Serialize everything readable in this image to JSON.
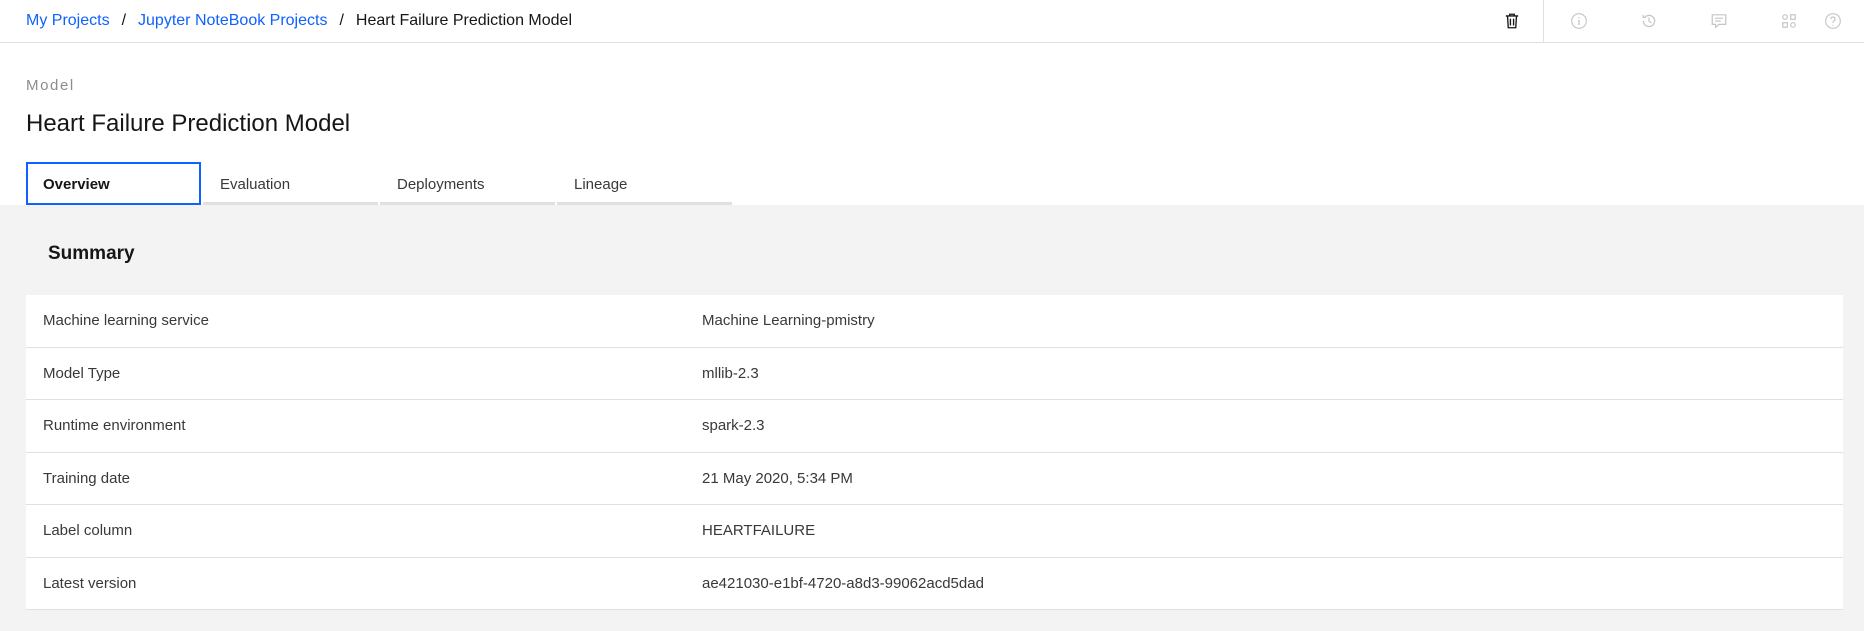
{
  "breadcrumb": {
    "items": [
      "My Projects",
      "Jupyter NoteBook Projects"
    ],
    "separator": "/",
    "current": "Heart Failure Prediction Model"
  },
  "toolbar": {
    "icons": [
      "trash-icon",
      "information-icon",
      "history-icon",
      "comments-icon",
      "data-assets-icon",
      "help-icon"
    ]
  },
  "header": {
    "eyebrow": "Model",
    "title": "Heart Failure Prediction Model"
  },
  "tabs": [
    {
      "label": "Overview",
      "active": true
    },
    {
      "label": "Evaluation",
      "active": false
    },
    {
      "label": "Deployments",
      "active": false
    },
    {
      "label": "Lineage",
      "active": false
    }
  ],
  "summary": {
    "title": "Summary",
    "rows": [
      {
        "label": "Machine learning service",
        "value": "Machine Learning-pmistry"
      },
      {
        "label": "Model Type",
        "value": "mllib-2.3"
      },
      {
        "label": "Runtime environment",
        "value": "spark-2.3"
      },
      {
        "label": "Training date",
        "value": "21 May 2020, 5:34 PM"
      },
      {
        "label": "Label column",
        "value": "HEARTFAILURE"
      },
      {
        "label": "Latest version",
        "value": "ae421030-e1bf-4720-a8d3-99062acd5dad"
      }
    ]
  },
  "colors": {
    "accent": "#0f62fe",
    "background": "#f3f3f3",
    "surface": "#ffffff",
    "text": "#161616",
    "muted": "#8d8d8d"
  }
}
